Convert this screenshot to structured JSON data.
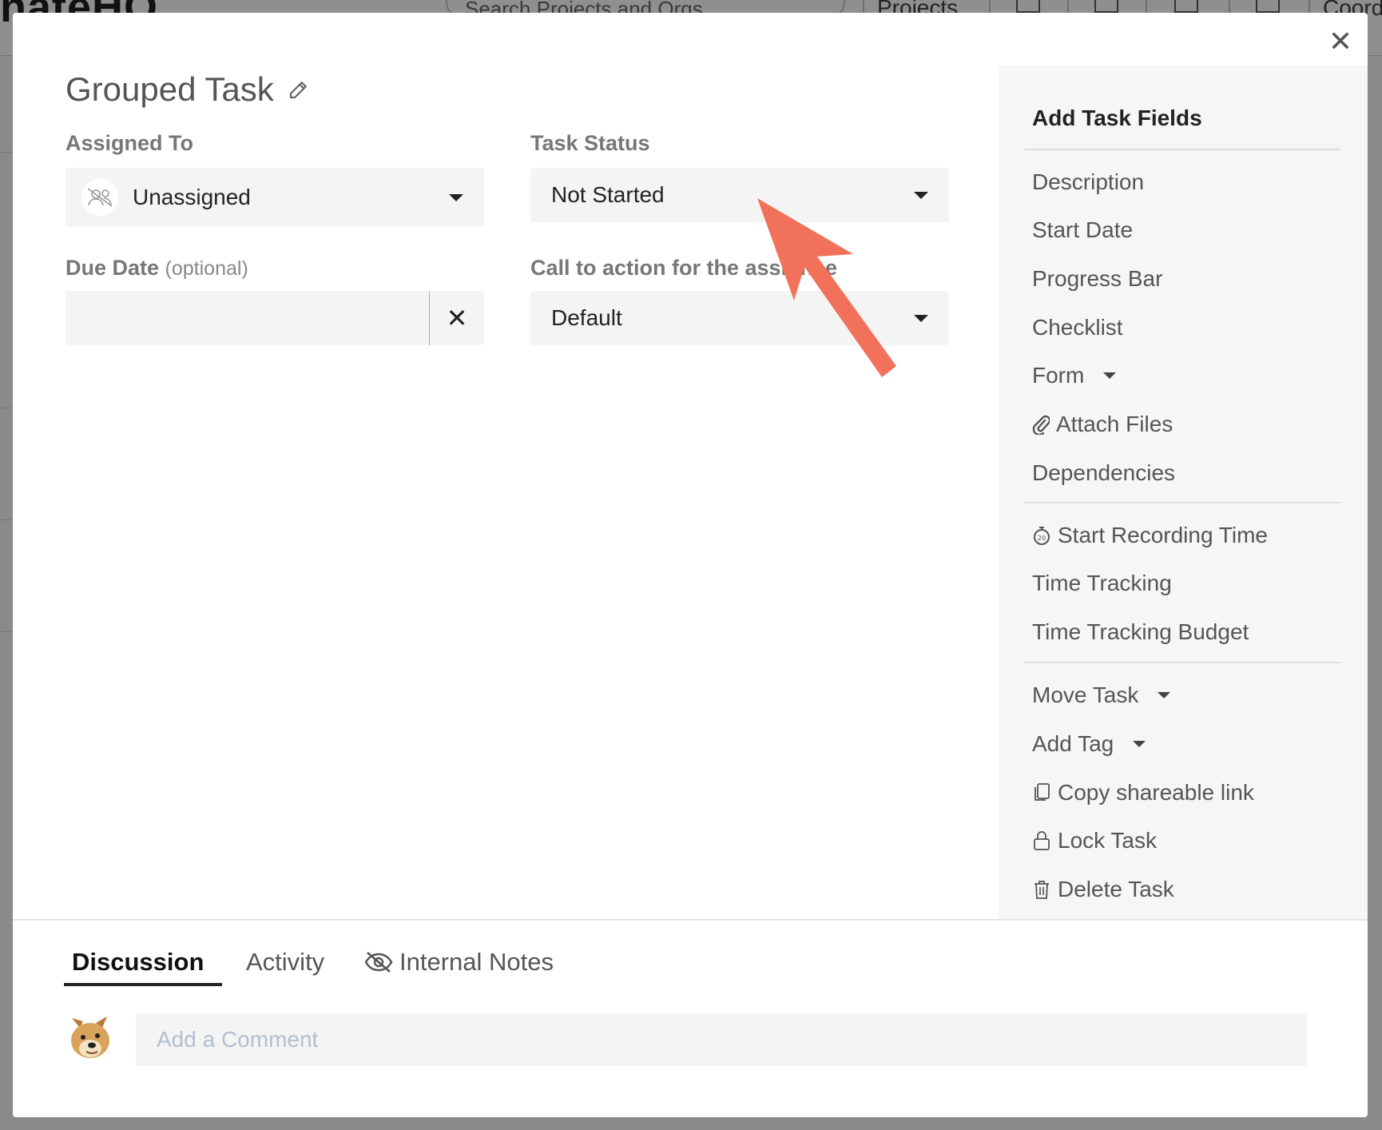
{
  "background": {
    "logo": "nateHQ",
    "search_placeholder": "Search Projects and Orgs",
    "nav_projects": "Projects",
    "nav_coord": "Coord"
  },
  "modal": {
    "title": "Grouped Task",
    "close_symbol": "✕",
    "assigned_to": {
      "label": "Assigned To",
      "value": "Unassigned"
    },
    "task_status": {
      "label": "Task Status",
      "value": "Not Started"
    },
    "due_date": {
      "label": "Due Date",
      "optional": "(optional)",
      "value": "",
      "clear_symbol": "✕"
    },
    "call_to_action": {
      "label": "Call to action for the assignee",
      "value": "Default"
    }
  },
  "side_panel": {
    "title": "Add Task Fields",
    "group1": [
      "Description",
      "Start Date",
      "Progress Bar",
      "Checklist",
      "Form",
      "Attach Files",
      "Dependencies"
    ],
    "group2": [
      "Start Recording Time",
      "Time Tracking",
      "Time Tracking Budget"
    ],
    "group3": [
      "Move Task",
      "Add Tag",
      "Copy shareable link",
      "Lock Task",
      "Delete Task"
    ]
  },
  "bottom": {
    "tabs": [
      "Discussion",
      "Activity",
      "Internal Notes"
    ],
    "active_tab": "Discussion",
    "comment_placeholder": "Add a Comment"
  },
  "colors": {
    "annotation_arrow": "#f2715a",
    "side_panel_bg": "#f6f6f6",
    "field_bg": "#f4f4f4"
  },
  "icons": {
    "title_edit": "edit-pencil-icon",
    "unassigned_avatar": "unassigned-users-icon",
    "attach": "paperclip-icon",
    "record": "stopwatch-icon",
    "copy": "copy-icon",
    "lock": "lock-icon",
    "delete": "trash-icon",
    "internal_notes": "eye-slash-icon"
  }
}
